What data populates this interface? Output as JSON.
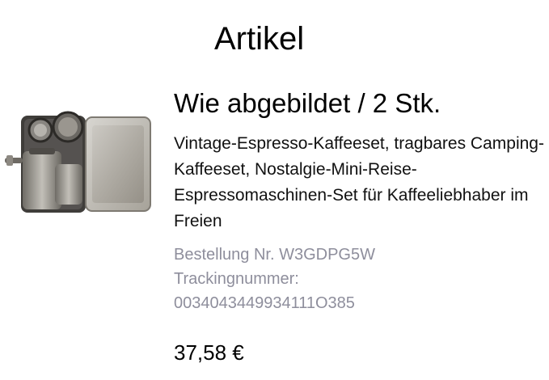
{
  "header": {
    "title": "Artikel"
  },
  "item": {
    "image_icon": "espresso-set-product-image",
    "title": "Wie abgebildet / 2 Stk.",
    "description": "Vintage-Espresso-Kaffeeset, tragbares Camping-Kaffeeset, Nostalgie-Mini-Reise-Espressomaschinen-Set für Kaffeeliebhaber im Freien",
    "order_line": "Bestellung Nr. W3GDPG5W",
    "tracking_label": "Trackingnummer:",
    "tracking_number": "0034043449934111O385",
    "price": "37,58 €"
  },
  "colors": {
    "meta_text": "#8e8e9c",
    "text": "#000000",
    "background": "#ffffff"
  }
}
